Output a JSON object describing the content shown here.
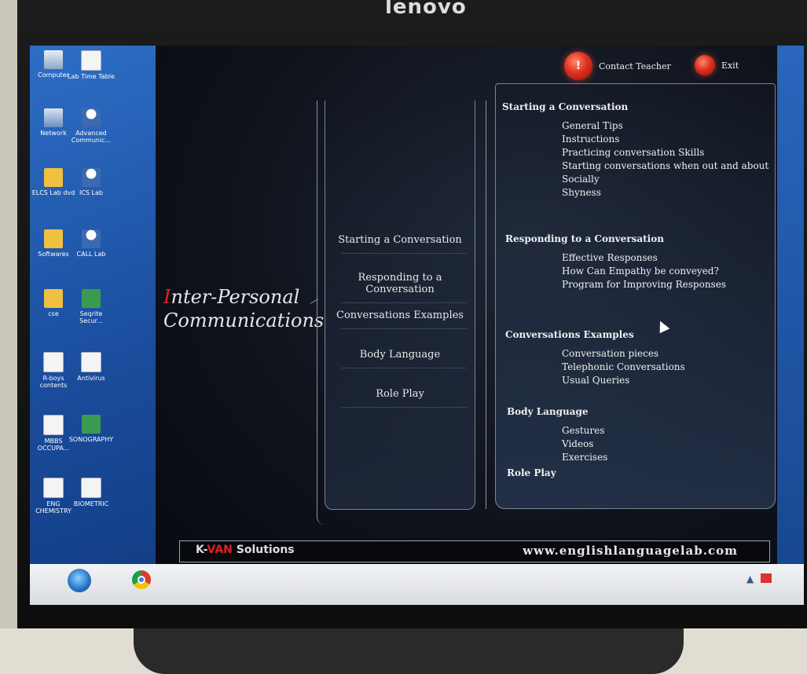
{
  "bezel": {
    "brand_fragment": "lenovo"
  },
  "desktop": {
    "icons": [
      {
        "label": "Computer",
        "icon": "computer-icon"
      },
      {
        "label": "Lab Time Table",
        "icon": "document-icon"
      },
      {
        "label": "Network",
        "icon": "network-icon"
      },
      {
        "label": "Advanced Communic...",
        "icon": "user-shortcut-icon"
      },
      {
        "label": "ELCS Lab dvd",
        "icon": "folder-icon"
      },
      {
        "label": "ICS Lab",
        "icon": "user-shortcut-icon"
      },
      {
        "label": "Softwares",
        "icon": "folder-icon"
      },
      {
        "label": "CALL Lab",
        "icon": "user-shortcut-icon"
      },
      {
        "label": "cse",
        "icon": "folder-icon"
      },
      {
        "label": "Seqrite Secur...",
        "icon": "security-icon"
      },
      {
        "label": "R-boys contents",
        "icon": "document-icon"
      },
      {
        "label": "Antivirus",
        "icon": "document-icon"
      },
      {
        "label": "MBBS OCCUPA...",
        "icon": "document-icon"
      },
      {
        "label": "SONOGRAPHY",
        "icon": "archive-icon"
      },
      {
        "label": "ENG CHEMISTRY",
        "icon": "document-icon"
      },
      {
        "label": "BIOMETRIC",
        "icon": "document-icon"
      }
    ]
  },
  "app": {
    "title_first_letter": "I",
    "title_rest_line1": "nter-Personal",
    "title_line2": "Communications",
    "contact_teacher": "Contact Teacher",
    "exit": "Exit",
    "menu": [
      "Starting a Conversation",
      "Responding to a Conversation",
      "Conversations Examples",
      "Body Language",
      "Role Play"
    ],
    "sections": [
      {
        "heading": "Starting a Conversation",
        "items": [
          "General Tips",
          "Instructions",
          "Practicing conversation Skills",
          "Starting conversations when out and about",
          "Socially",
          "Shyness"
        ]
      },
      {
        "heading": "Responding to a Conversation",
        "items": [
          "Effective Responses",
          "How Can Empathy be conveyed?",
          "Program for Improving Responses"
        ]
      },
      {
        "heading": "Conversations Examples",
        "items": [
          "Conversation pieces",
          "Telephonic Conversations",
          "Usual Queries"
        ]
      },
      {
        "heading": "Body Language",
        "items": [
          "Gestures",
          "Videos",
          "Exercises"
        ]
      },
      {
        "heading": "Role Play",
        "items": []
      }
    ],
    "footer": {
      "brand_k": "K-",
      "brand_van": "VAN",
      "brand_rest": " Solutions",
      "url": "www.englishlanguagelab.com"
    }
  },
  "colors": {
    "accent_red": "#e02020",
    "desktop_blue": "#1a4c9c",
    "app_background": "#0f131c"
  }
}
